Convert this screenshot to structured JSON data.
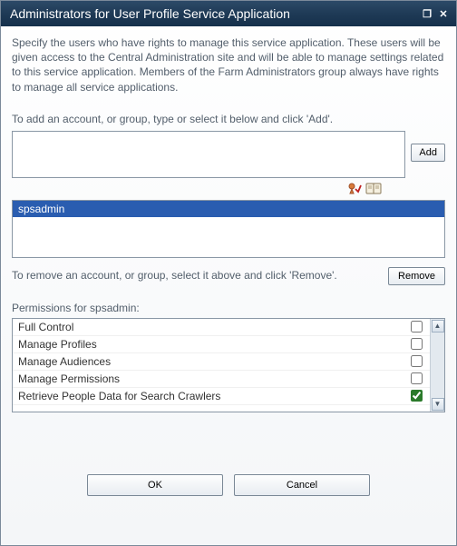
{
  "titlebar": {
    "title": "Administrators for User Profile Service Application"
  },
  "description": "Specify the users who have rights to manage this service application. These users will be given access to the Central Administration site and will be able to manage settings related to this service application. Members of the Farm Administrators group always have rights to manage all service applications.",
  "add_instruction": "To add an account, or group, type or select it below and click 'Add'.",
  "add_button": "Add",
  "selected_user": "spsadmin",
  "remove_instruction": "To remove an account, or group, select it above and click 'Remove'.",
  "remove_button": "Remove",
  "permissions_label": "Permissions for spsadmin:",
  "permissions": [
    {
      "label": "Full Control",
      "checked": false
    },
    {
      "label": "Manage Profiles",
      "checked": false
    },
    {
      "label": "Manage Audiences",
      "checked": false
    },
    {
      "label": "Manage Permissions",
      "checked": false
    },
    {
      "label": "Retrieve People Data for Search Crawlers",
      "checked": true
    }
  ],
  "ok_button": "OK",
  "cancel_button": "Cancel",
  "icons": {
    "check_names": "check-names-icon",
    "browse": "browse-directory-icon"
  }
}
